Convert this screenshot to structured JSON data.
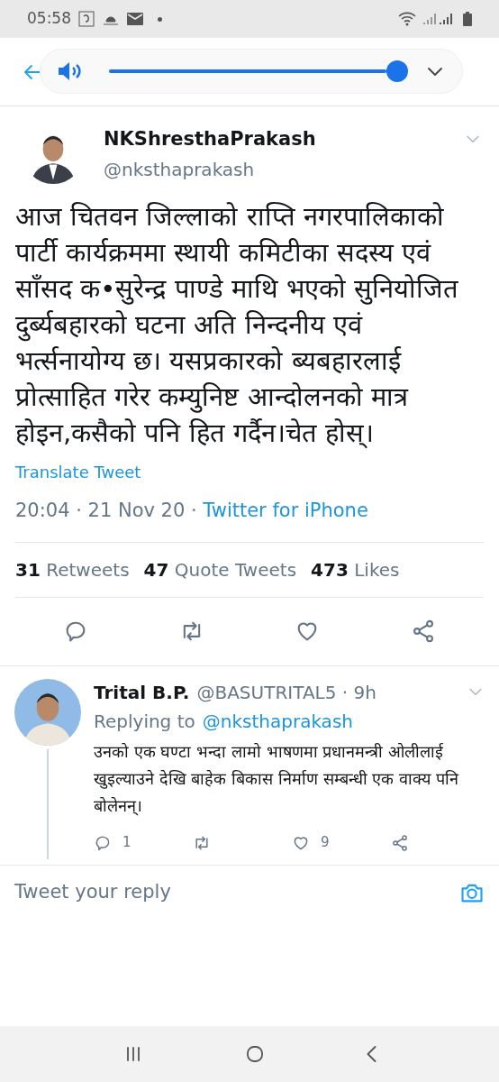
{
  "status_bar": {
    "time": "05:58"
  },
  "header": {
    "volume": {
      "level": 1
    }
  },
  "tweet": {
    "name": "NKShresthaPrakash",
    "handle": "@nksthaprakash",
    "text": "आज चितवन जिल्लाको राप्ति नगरपालिकाको पार्टी कार्यक्रममा स्थायी कमिटीका सदस्य एवं साँसद क•सुरेन्द्र पाण्डे माथि भएको सुनियोजित दुर्ब्यबहारको घटना अति निन्दनीय एवं भर्त्सनायोग्य छ। यसप्रकारको ब्यबहारलाई प्रोत्साहित गरेर कम्युनिष्ट आन्दोलनको मात्र होइन,कसैको पनि हित गर्दैन।चेत होस्।",
    "translate": "Translate Tweet",
    "timestamp": "20:04 · 21 Nov 20 · ",
    "source": "Twitter for iPhone",
    "stats": [
      {
        "count": "31",
        "label": "Retweets"
      },
      {
        "count": "47",
        "label": "Quote Tweets"
      },
      {
        "count": "473",
        "label": "Likes"
      }
    ]
  },
  "reply": {
    "name": "Trital B.P.",
    "handle": "@BASUTRITAL5 · 9h",
    "replying_label": "Replying to",
    "replying_handle": "@nksthaprakash",
    "text": "उनको एक घण्टा भन्दा लामो भाषणमा प्रधानमन्त्री ओलीलाई खुइल्याउने देखि बाहेक बिकास निर्माण सम्बन्धी एक वाक्य पनि बोलेनन्।",
    "reply_count": "1",
    "like_count": "9"
  },
  "composer": {
    "placeholder": "Tweet your reply"
  }
}
